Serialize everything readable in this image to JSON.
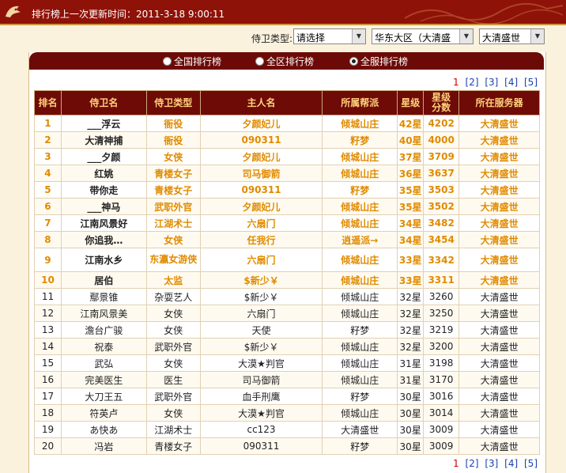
{
  "header": {
    "title": "排行榜上一次更新时间：2011-3-18 9:00:11"
  },
  "filters": {
    "type_label": "侍卫类型:",
    "type_value": "请选择",
    "region_value": "华东大区（大清盛",
    "server_value": "大清盛世"
  },
  "tabs": [
    {
      "label": "全国排行榜",
      "selected": false
    },
    {
      "label": "全区排行榜",
      "selected": false
    },
    {
      "label": "全服排行榜",
      "selected": true
    }
  ],
  "pager": {
    "current": "1",
    "pages": [
      "[2]",
      "[3]",
      "[4]",
      "[5]"
    ]
  },
  "table": {
    "headers": [
      "排名",
      "侍卫名",
      "侍卫类型",
      "主人名",
      "所属帮派",
      "星级",
      "星级分数",
      "所在服务器"
    ],
    "rows": [
      [
        "1",
        "___浮云",
        "衙役",
        "夕颜妃儿",
        "倾城山庄",
        "42星",
        "4202",
        "大清盛世"
      ],
      [
        "2",
        "大清神捕",
        "衙役",
        "090311",
        "籽梦",
        "40星",
        "4000",
        "大清盛世"
      ],
      [
        "3",
        "___夕颜",
        "女侠",
        "夕颜妃儿",
        "倾城山庄",
        "37星",
        "3709",
        "大清盛世"
      ],
      [
        "4",
        "红姚",
        "青楼女子",
        "司马御箭",
        "倾城山庄",
        "36星",
        "3637",
        "大清盛世"
      ],
      [
        "5",
        "带你走",
        "青楼女子",
        "090311",
        "籽梦",
        "35星",
        "3503",
        "大清盛世"
      ],
      [
        "6",
        "___神马",
        "武职外官",
        "夕颜妃儿",
        "倾城山庄",
        "35星",
        "3502",
        "大清盛世"
      ],
      [
        "7",
        "江南风景好",
        "江湖术士",
        "六扇门",
        "倾城山庄",
        "34星",
        "3482",
        "大清盛世"
      ],
      [
        "8",
        "你追我…",
        "女侠",
        "任我行",
        "逍遥派→",
        "34星",
        "3454",
        "大清盛世"
      ],
      [
        "9",
        "江南水乡",
        "东瀛女游侠",
        "六扇门",
        "倾城山庄",
        "33星",
        "3342",
        "大清盛世"
      ],
      [
        "10",
        "居伯",
        "太监",
        "$新少￥",
        "倾城山庄",
        "33星",
        "3311",
        "大清盛世"
      ],
      [
        "11",
        "鄢景锥",
        "杂耍艺人",
        "$新少￥",
        "倾城山庄",
        "32星",
        "3260",
        "大清盛世"
      ],
      [
        "12",
        "江南风景美",
        "女侠",
        "六扇门",
        "倾城山庄",
        "32星",
        "3250",
        "大清盛世"
      ],
      [
        "13",
        "澹台广骏",
        "女侠",
        "天使",
        "籽梦",
        "32星",
        "3219",
        "大清盛世"
      ],
      [
        "14",
        "祝泰",
        "武职外官",
        "$新少￥",
        "倾城山庄",
        "32星",
        "3200",
        "大清盛世"
      ],
      [
        "15",
        "武弘",
        "女侠",
        "大漠★判官",
        "倾城山庄",
        "31星",
        "3198",
        "大清盛世"
      ],
      [
        "16",
        "完美医生",
        "医生",
        "司马御箭",
        "倾城山庄",
        "31星",
        "3170",
        "大清盛世"
      ],
      [
        "17",
        "大刀王五",
        "武职外官",
        "血手刑鹰",
        "籽梦",
        "30星",
        "3016",
        "大清盛世"
      ],
      [
        "18",
        "符英卢",
        "女侠",
        "大漠★判官",
        "倾城山庄",
        "30星",
        "3014",
        "大清盛世"
      ],
      [
        "19",
        "あ快あ",
        "江湖术士",
        "cc123",
        "大清盛世",
        "30星",
        "3009",
        "大清盛世"
      ],
      [
        "20",
        "冯岩",
        "青楼女子",
        "090311",
        "籽梦",
        "30星",
        "3009",
        "大清盛世"
      ]
    ]
  },
  "colors": {
    "header_red": "#8f1208",
    "table_head": "#6e0b07",
    "top_orange": "#e08b00",
    "background": "#fbf2de"
  },
  "icons": {
    "logo": "dragon-logo-icon",
    "banner": "dragon-ornament-icon"
  }
}
